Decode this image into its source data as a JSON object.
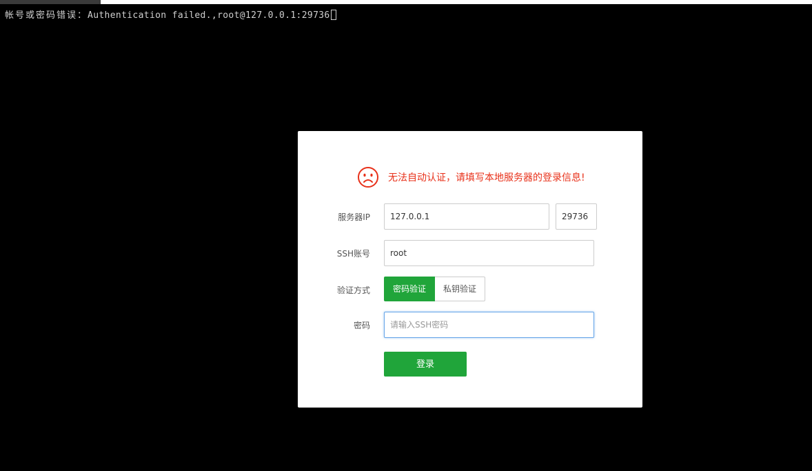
{
  "terminal": {
    "error_prefix": "帐号或密码错误：",
    "error_message": "Authentication failed.,root@127.0.0.1:29736"
  },
  "dialog": {
    "message": "无法自动认证，请填写本地服务器的登录信息!",
    "icon": "sad-face-icon",
    "colors": {
      "error": "#e8311a",
      "accent": "#20a53a",
      "focus": "#66a5e8"
    },
    "server": {
      "label": "服务器IP",
      "ip_value": "127.0.0.1",
      "port_value": "29736"
    },
    "account": {
      "label": "SSH账号",
      "value": "root"
    },
    "auth": {
      "label": "验证方式",
      "options": [
        "密码验证",
        "私钥验证"
      ],
      "selected": "密码验证"
    },
    "password": {
      "label": "密码",
      "placeholder": "请输入SSH密码",
      "value": ""
    },
    "login_button": "登录"
  }
}
